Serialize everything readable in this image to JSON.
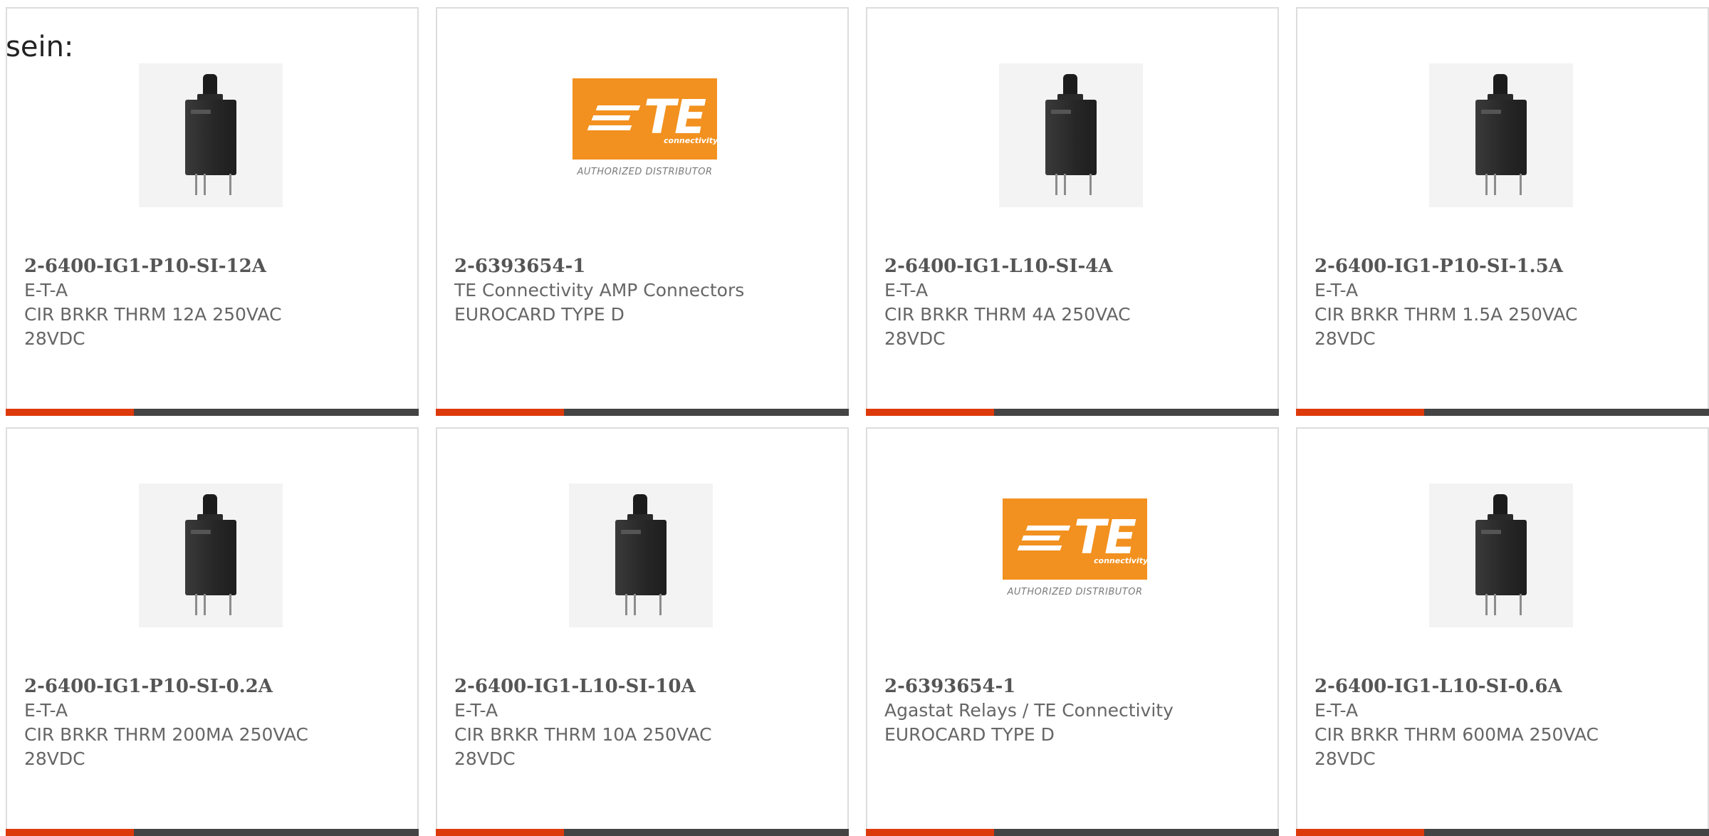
{
  "intro_text": "sein:",
  "accent_fraction": 0.31,
  "colors": {
    "accent": "#dd3a0c",
    "bar": "#444444",
    "te_orange": "#f2911f"
  },
  "te_logo": {
    "word": "TE",
    "sub": "connectivity",
    "tagline": "AUTHORIZED DISTRIBUTOR"
  },
  "cards": [
    {
      "image": "circuit-breaker",
      "part_number": "2-6400-IG1-P10-SI-12A",
      "manufacturer": "E-T-A",
      "desc1": "CIR BRKR THRM 12A 250VAC",
      "desc2": "28VDC"
    },
    {
      "image": "te-logo",
      "part_number": "2-6393654-1",
      "manufacturer": "TE Connectivity AMP Connectors",
      "desc1": "EUROCARD TYPE D",
      "desc2": ""
    },
    {
      "image": "circuit-breaker",
      "part_number": "2-6400-IG1-L10-SI-4A",
      "manufacturer": "E-T-A",
      "desc1": "CIR BRKR THRM 4A 250VAC",
      "desc2": "28VDC"
    },
    {
      "image": "circuit-breaker",
      "part_number": "2-6400-IG1-P10-SI-1.5A",
      "manufacturer": "E-T-A",
      "desc1": "CIR BRKR THRM 1.5A 250VAC",
      "desc2": "28VDC"
    },
    {
      "image": "circuit-breaker",
      "part_number": "2-6400-IG1-P10-SI-0.2A",
      "manufacturer": "E-T-A",
      "desc1": "CIR BRKR THRM 200MA 250VAC",
      "desc2": "28VDC"
    },
    {
      "image": "circuit-breaker",
      "part_number": "2-6400-IG1-L10-SI-10A",
      "manufacturer": "E-T-A",
      "desc1": "CIR BRKR THRM 10A 250VAC",
      "desc2": "28VDC"
    },
    {
      "image": "te-logo",
      "part_number": "2-6393654-1",
      "manufacturer": "Agastat Relays / TE Connectivity",
      "desc1": "EUROCARD TYPE D",
      "desc2": ""
    },
    {
      "image": "circuit-breaker",
      "part_number": "2-6400-IG1-L10-SI-0.6A",
      "manufacturer": "E-T-A",
      "desc1": "CIR BRKR THRM 600MA 250VAC",
      "desc2": "28VDC"
    }
  ]
}
